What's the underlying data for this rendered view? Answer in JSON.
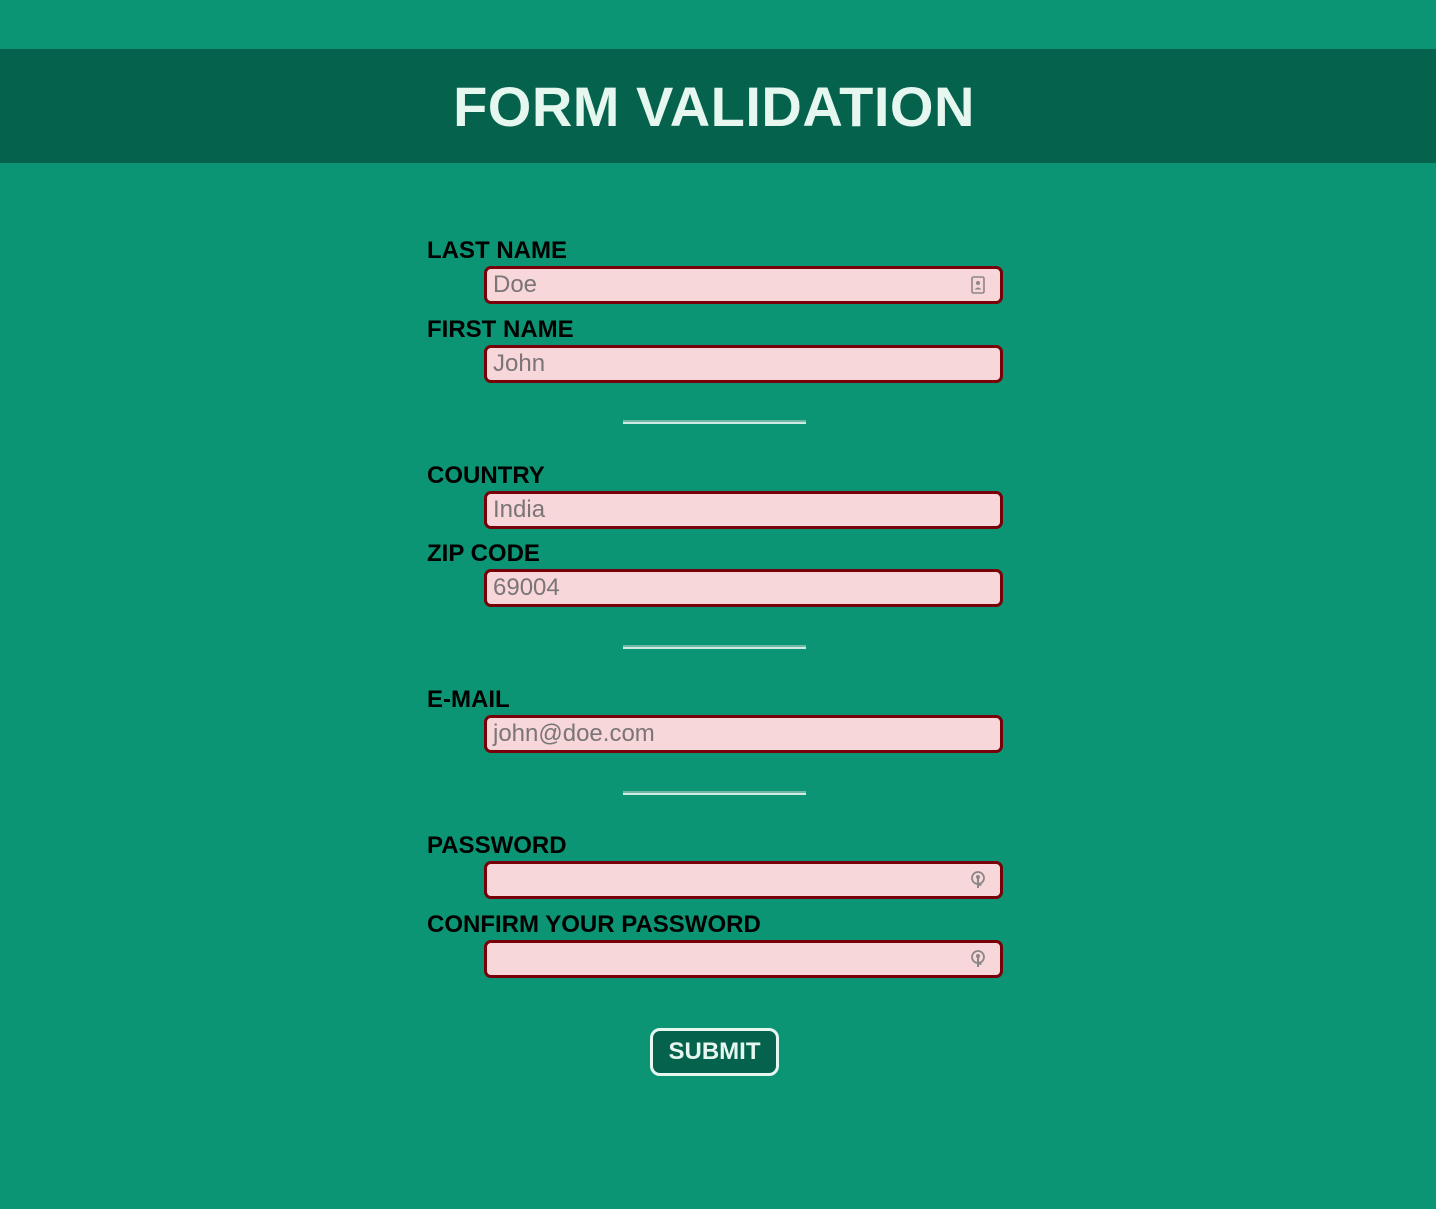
{
  "header": {
    "title": "FORM VALIDATION"
  },
  "form": {
    "last_name": {
      "label": "LAST NAME",
      "value": "Doe",
      "icon": "contact-card-icon"
    },
    "first_name": {
      "label": "FIRST NAME",
      "value": "John"
    },
    "country": {
      "label": "COUNTRY",
      "value": "India"
    },
    "zip_code": {
      "label": "ZIP CODE",
      "value": "69004"
    },
    "email": {
      "label": "E-MAIL",
      "value": "john@doe.com"
    },
    "password": {
      "label": "PASSWORD",
      "value": "",
      "icon": "key-icon"
    },
    "confirm_password": {
      "label": "CONFIRM YOUR PASSWORD",
      "value": "",
      "icon": "key-icon"
    },
    "submit_label": "SUBMIT"
  },
  "colors": {
    "background": "#0c9574",
    "header": "#05634d",
    "field_fill": "#f8d7da",
    "field_border": "#780008"
  }
}
